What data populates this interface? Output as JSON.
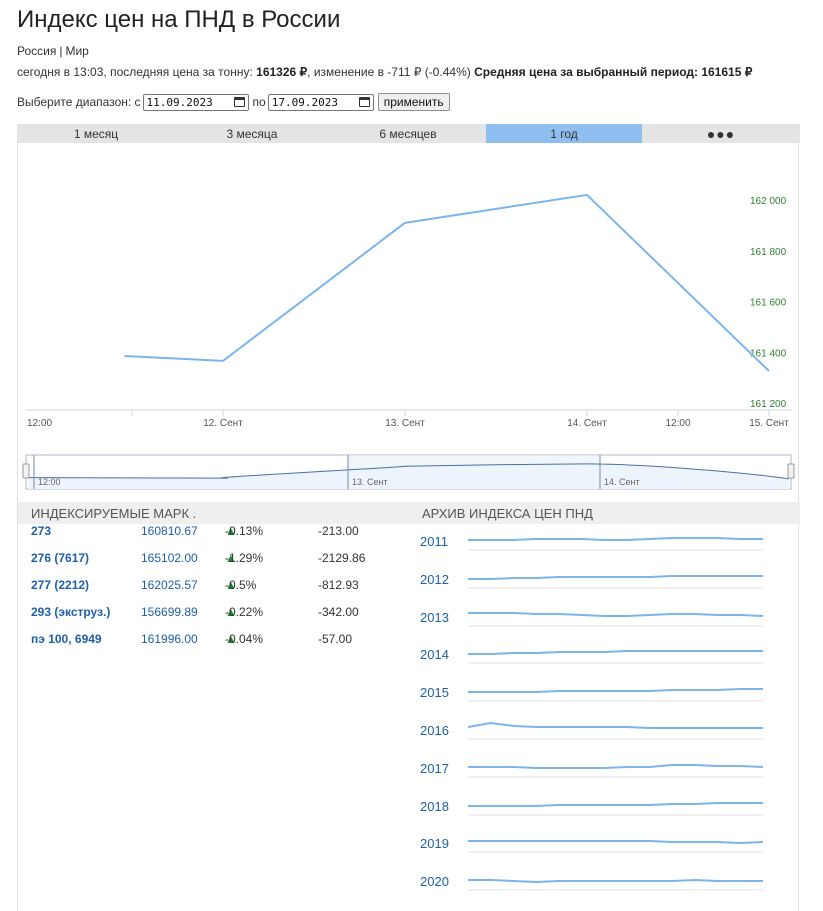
{
  "header": {
    "title": "Индекс цен на ПНД в России",
    "region": "Россия",
    "region_world": "Мир",
    "summary_prefix": "сегодня в 13:03, последняя цена за тонну:",
    "last_price": "161326 ₽",
    "change_text": ", изменение в -711 ₽ (-0.44%)",
    "avg_label": "Средняя цена за выбранный период: 161615 ₽"
  },
  "range": {
    "label": "Выберите диапазон: с",
    "from": "11.09.2023",
    "to_label": "по",
    "to": "17.09.2023",
    "apply": "применить"
  },
  "tabs": [
    {
      "label": "1 месяц",
      "active": false
    },
    {
      "label": "3 месяца",
      "active": false
    },
    {
      "label": "6 месяцев",
      "active": false
    },
    {
      "label": "1 год",
      "active": true
    },
    {
      "label": "●●●",
      "active": false
    }
  ],
  "chart_data": {
    "type": "line",
    "x": [
      "2023-09-11 11:00",
      "2023-09-12 00:00",
      "2023-09-13 00:00",
      "2023-09-14 00:00",
      "2023-09-15 00:00"
    ],
    "y": [
      161385,
      161366,
      161910,
      162020,
      161326
    ],
    "ylim": [
      161200,
      162000
    ],
    "yticks": [
      "161 200",
      "161 400",
      "161 600",
      "161 800",
      "162 000"
    ],
    "xticks": [
      "12:00",
      "12. Сент",
      "13. Сент",
      "14. Сент",
      "12:00",
      "15. Сент"
    ],
    "navigator_labels": [
      "12:00",
      "13. Сент",
      "14. Сент"
    ],
    "line_color": "#7cb5ec",
    "tick_color": "#2e7d32",
    "grid": false
  },
  "grades_section": {
    "title": "ИНДЕКСИРУЕМЫЕ МАРК .",
    "rows": [
      {
        "name": "273",
        "price": "160810.67",
        "pct": "-0.13%",
        "delta": "-213.00"
      },
      {
        "name": "276 (7617)",
        "price": "165102.00",
        "pct": "-1.29%",
        "delta": "-2129.86"
      },
      {
        "name": "277 (2212)",
        "price": "162025.57",
        "pct": "-0.5%",
        "delta": "-812.93"
      },
      {
        "name": "293 (экструз.)",
        "price": "156699.89",
        "pct": "-0.22%",
        "delta": "-342.00"
      },
      {
        "name": "пэ 100, 6949",
        "price": "161996.00",
        "pct": "-0.04%",
        "delta": "-57.00"
      }
    ],
    "arrow": "▲"
  },
  "archive_section": {
    "title": "АРХИВ ИНДЕКСА ЦЕН ПНД",
    "years": [
      "2011",
      "2012",
      "2013",
      "2014",
      "2015",
      "2016",
      "2017",
      "2018",
      "2019",
      "2020"
    ]
  }
}
